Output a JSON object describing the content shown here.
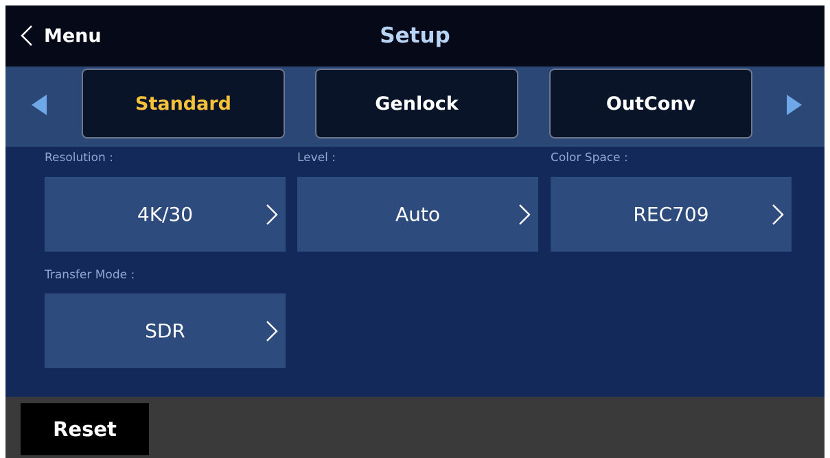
{
  "header": {
    "back_label": "Menu",
    "title": "Setup"
  },
  "tabs": [
    {
      "label": "Standard",
      "active": true
    },
    {
      "label": "Genlock",
      "active": false
    },
    {
      "label": "OutConv",
      "active": false
    }
  ],
  "fields": {
    "resolution": {
      "label": "Resolution :",
      "value": "4K/30"
    },
    "level": {
      "label": "Level :",
      "value": "Auto"
    },
    "color_space": {
      "label": "Color Space :",
      "value": "REC709"
    },
    "transfer_mode": {
      "label": "Transfer Mode :",
      "value": "SDR"
    }
  },
  "footer": {
    "reset_label": "Reset"
  },
  "colors": {
    "header_bg": "#060a18",
    "title": "#b9d3f5",
    "tabbar_bg": "#2b4775",
    "content_bg": "#13295a",
    "field_bg": "#2e4b7e",
    "active_tab_text": "#f5c23a",
    "arrow": "#6fa8e8",
    "footer_bg": "#3a3a3a"
  },
  "icons": {
    "back": "chevron-left-icon",
    "prev": "triangle-left-icon",
    "next": "triangle-right-icon",
    "field_open": "chevron-right-icon"
  }
}
